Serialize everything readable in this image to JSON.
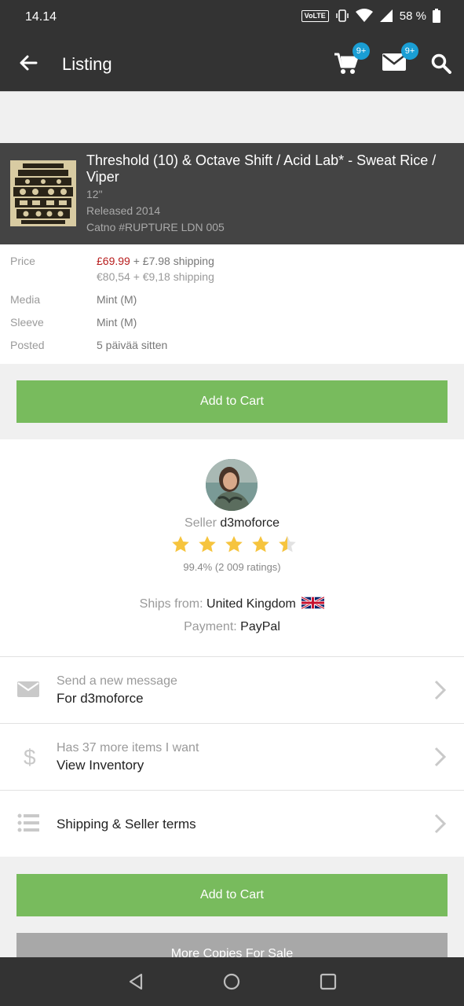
{
  "status": {
    "time": "14.14",
    "volte": "VoLTE",
    "battery": "58 %"
  },
  "appbar": {
    "title": "Listing",
    "cart_badge": "9+",
    "mail_badge": "9+"
  },
  "release": {
    "title": "Threshold (10) & Octave Shift / Acid Lab* - Sweat Rice / Viper",
    "format": "12\"",
    "released": "Released 2014",
    "catno": "Catno #RUPTURE LDN 005"
  },
  "details": {
    "price_label": "Price",
    "price": "£69.99",
    "shipping": " + £7.98 shipping",
    "converted": "€80,54 + €9,18 shipping",
    "media_label": "Media",
    "media": "Mint (M)",
    "sleeve_label": "Sleeve",
    "sleeve": "Mint (M)",
    "posted_label": "Posted",
    "posted": "5 päivää sitten"
  },
  "buttons": {
    "add_to_cart": "Add to Cart",
    "more_copies": "More Copies For Sale"
  },
  "seller": {
    "label": "Seller",
    "name": "d3moforce",
    "rating_value": 4.5,
    "ratings": "99.4% (2 009 ratings)",
    "ships_label": "Ships from:",
    "ships_from": "United Kingdom",
    "payment_label": "Payment:",
    "payment": "PayPal"
  },
  "list": [
    {
      "sub": "Send a new message",
      "main": "For d3moforce",
      "icon": "envelope-icon"
    },
    {
      "sub": "Has 37 more items I want",
      "main": "View Inventory",
      "icon": "dollar-icon"
    },
    {
      "main": "Shipping & Seller terms",
      "icon": "list-icon"
    }
  ],
  "colors": {
    "bar": "#333333",
    "accent_green": "#78bb5d",
    "price_red": "#b71c1c",
    "badge_blue": "#1a9ed4",
    "star_gold": "#f6c43e"
  }
}
